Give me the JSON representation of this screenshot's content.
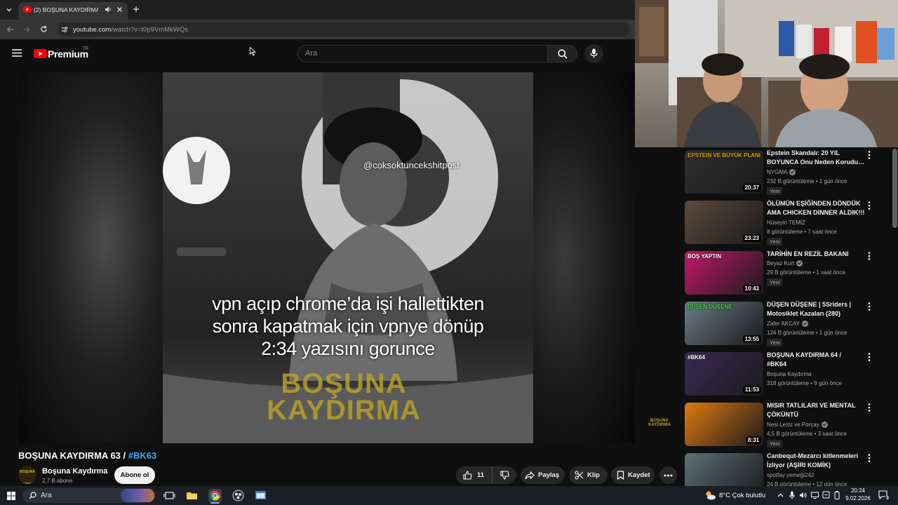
{
  "browser": {
    "tab_title": "(2) BOŞUNA KAYDIRMA 63",
    "url_domain": "youtube.com",
    "url_path": "/watch?v=t0p9VmMkWQs"
  },
  "header": {
    "logo_text": "Premium",
    "region": "TR",
    "search_placeholder": "Ara"
  },
  "player": {
    "overlay_handle": "@coksoktuncekshitpost",
    "caption_lines": [
      "vpn açıp chrome’da işi hallettikten",
      "sonra kapatmak için vpnye dönüp",
      "2:34 yazısını gorunce"
    ],
    "brand_line1": "BOŞUNA",
    "brand_line2": "KAYDIRMA",
    "corner_line1": "BOŞUNA",
    "corner_line2": "KAYDIRMA"
  },
  "video": {
    "title": "BOŞUNA KAYDIRMA 63 / ",
    "hashtag": "#BK63",
    "channel_name": "Boşuna Kaydırma",
    "subscribers": "2,7 B abone",
    "subscribe_label": "Abone ol",
    "likes": "11",
    "share_label": "Paylaş",
    "clip_label": "Klip",
    "save_label": "Kaydet"
  },
  "recommendations": [
    {
      "thumb_caption": "EPSTEIN VE BÜYÜK PLANI",
      "title1": "Epstein Skandalı: 20 YIL",
      "title2": "BOYUNCA Onu Neden Korudul...",
      "channel": "NYGMA",
      "verified": true,
      "meta": "232 B görüntüleme • 1 gün önce",
      "badge": "Yeni",
      "duration": "20:37",
      "thumb_color": "#2f2f2f",
      "accent": "#d8a400"
    },
    {
      "thumb_caption": "",
      "title1": "ÖLÜMÜN EŞİĞİNDEN DÖNDÜK",
      "title2": "AMA CHICKEN DINNER ALDIK!!!",
      "channel": "Hüseyin TEMİZ",
      "verified": false,
      "meta": "8 görüntüleme • 7 saat önce",
      "badge": "Yeni",
      "duration": "23:23",
      "thumb_color": "#5a4a3e",
      "accent": "#8a7260"
    },
    {
      "thumb_caption": "BOŞ YAPTIN",
      "title1": "TARİHİN EN REZİL BAKANI",
      "title2": "",
      "channel": "Beyaz Kurt",
      "verified": true,
      "meta": "29 B görüntüleme • 1 saat önce",
      "badge": "Yeni",
      "duration": "10:43",
      "thumb_color": "#c2186a",
      "accent": "#ffffff"
    },
    {
      "thumb_caption": "DÜŞEN DÜŞENE",
      "title1": "DÜŞEN DÜŞENE | 5Sriders |",
      "title2": "Motosiklet Kazaları (280)",
      "channel": "Zafer AKCAY",
      "verified": true,
      "meta": "124 B görüntüleme • 1 gün önce",
      "badge": "Yeni",
      "duration": "13:55",
      "thumb_color": "#6c7a86",
      "accent": "#40d040"
    },
    {
      "thumb_caption": "#BK64",
      "title1": "BOŞUNA KAYDIRMA 64 /",
      "title2": "#BK64",
      "channel": "Boşuna Kaydırma",
      "verified": false,
      "meta": "318 görüntüleme • 9 gün önce",
      "badge": "",
      "duration": "11:53",
      "thumb_color": "#3a2a55",
      "accent": "#ffffff"
    },
    {
      "thumb_caption": "",
      "title1": "MISIR TATLILARI VE MENTAL",
      "title2": "ÇÖKÜNTÜ",
      "channel": "Nesi Leziz ve Porçay",
      "verified": true,
      "meta": "4,5 B görüntüleme • 3 saat önce",
      "badge": "Yeni",
      "duration": "8:31",
      "thumb_color": "#e07a10",
      "accent": "#ffd040"
    },
    {
      "thumb_caption": "",
      "title1": "Canbequt-Mezarcı kitlenmeleri",
      "title2": "İzliyor (AŞIRI KOMİK)",
      "channel": "spotfay yemeği242",
      "verified": false,
      "meta": "24 B görüntüleme • 12 gün önce",
      "badge": "",
      "duration": "12:20",
      "thumb_color": "#5d6f78",
      "accent": "#8fb0c0"
    }
  ],
  "taskbar": {
    "search_text": "Ara",
    "weather": "8°C  Çok bulutlu",
    "time": "20:24",
    "date": "9.02.2026",
    "notifications": "3"
  }
}
